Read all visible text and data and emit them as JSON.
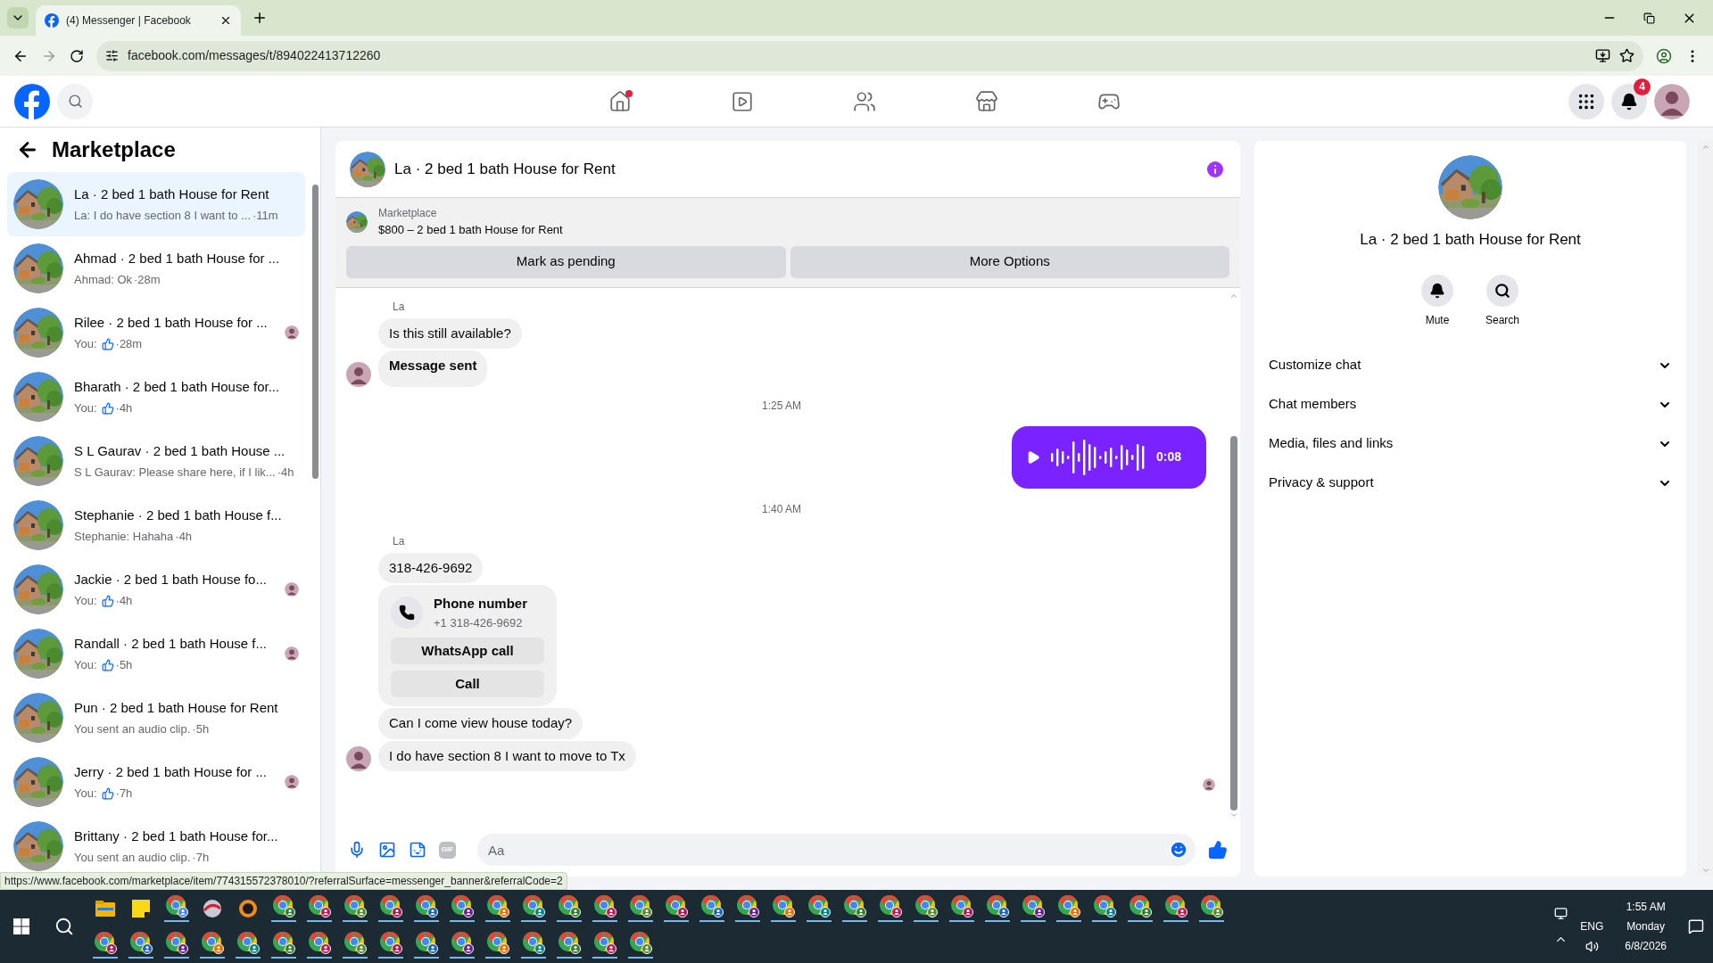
{
  "browser": {
    "tab_title": "(4) Messenger | Facebook",
    "url": "facebook.com/messages/t/894022413712260",
    "status_url": "https://www.facebook.com/marketplace/item/774315572378010/?referralSurface=messenger_banner&referralCode=2"
  },
  "header": {
    "nav": [
      {
        "kind": "home",
        "dot": true
      },
      {
        "kind": "video",
        "dot": false
      },
      {
        "kind": "friends",
        "dot": false
      },
      {
        "kind": "marketplace",
        "dot": false
      },
      {
        "kind": "gaming",
        "dot": false
      }
    ],
    "notification_count": "4"
  },
  "sidebar": {
    "title": "Marketplace",
    "conversations": [
      {
        "title": "La · 2 bed 1 bath House for Rent",
        "kind": "text",
        "preview": "La: I do have section 8 I want to ...",
        "time": " ·11m",
        "selected": true,
        "read_receipt": false
      },
      {
        "title": "Ahmad · 2 bed 1 bath House for ...",
        "kind": "text",
        "preview": "Ahmad: Ok",
        "time": "·28m",
        "selected": false,
        "read_receipt": false
      },
      {
        "title": "Rilee · 2 bed 1 bath House for ...",
        "kind": "like",
        "preview": "You:",
        "time": "·28m",
        "selected": false,
        "read_receipt": true
      },
      {
        "title": "Bharath · 2 bed 1 bath House for...",
        "kind": "like",
        "preview": "You:",
        "time": "·4h",
        "selected": false,
        "read_receipt": false
      },
      {
        "title": "S L Gaurav · 2 bed 1 bath House ...",
        "kind": "text",
        "preview": "S L Gaurav: Please share here, if I lik...",
        "time": "·4h",
        "selected": false,
        "read_receipt": false
      },
      {
        "title": "Stephanie · 2 bed 1 bath House f...",
        "kind": "text",
        "preview": "Stephanie: Hahaha",
        "time": "·4h",
        "selected": false,
        "read_receipt": false
      },
      {
        "title": "Jackie · 2 bed 1 bath House fo...",
        "kind": "like",
        "preview": "You:",
        "time": "·4h",
        "selected": false,
        "read_receipt": true
      },
      {
        "title": "Randall · 2 bed 1 bath House f...",
        "kind": "like",
        "preview": "You:",
        "time": "·5h",
        "selected": false,
        "read_receipt": true
      },
      {
        "title": "Pun · 2 bed 1 bath House for Rent",
        "kind": "text",
        "preview": "You sent an audio clip.",
        "time": "·5h",
        "selected": false,
        "read_receipt": false
      },
      {
        "title": "Jerry · 2 bed 1 bath House for ...",
        "kind": "like",
        "preview": "You:",
        "time": "·7h",
        "selected": false,
        "read_receipt": true
      },
      {
        "title": "Brittany · 2 bed 1 bath House for...",
        "kind": "text",
        "preview": "You sent an audio clip.",
        "time": "·7h",
        "selected": false,
        "read_receipt": false
      }
    ]
  },
  "chat": {
    "title": "La · 2 bed 1 bath House for Rent",
    "listing": {
      "label": "Marketplace",
      "text": "$800 – 2 bed 1 bath House for Rent"
    },
    "actions": [
      "Mark as pending",
      "More Options"
    ],
    "messages": [
      {
        "kind": "sender",
        "text": "La"
      },
      {
        "kind": "incoming",
        "text": "Is this still available?",
        "bold": false,
        "avatar": false
      },
      {
        "kind": "incoming",
        "text": "Message sent",
        "bold": true,
        "avatar": true
      },
      {
        "kind": "time",
        "text": "1:25 AM"
      },
      {
        "kind": "audio",
        "duration": "0:08"
      },
      {
        "kind": "time",
        "text": "1:40 AM"
      },
      {
        "kind": "sender",
        "text": "La"
      },
      {
        "kind": "incoming",
        "text": "318-426-9692",
        "bold": false,
        "avatar": false
      },
      {
        "kind": "contact",
        "title": "Phone number",
        "subtitle": "+1 318-426-9692",
        "buttons": [
          "WhatsApp call",
          "Call"
        ]
      },
      {
        "kind": "incoming",
        "text": "Can I come view house today?",
        "bold": false,
        "avatar": false
      },
      {
        "kind": "incoming",
        "text": "I do have section 8 I want to move to Tx",
        "bold": false,
        "avatar": true
      }
    ],
    "composer": {
      "placeholder": "Aa",
      "gif_label": "GIF"
    }
  },
  "details": {
    "title": "La · 2 bed 1 bath House for Rent",
    "actions": [
      {
        "kind": "mute",
        "label": "Mute"
      },
      {
        "kind": "search",
        "label": "Search"
      }
    ],
    "sections": [
      {
        "label": "Customize chat",
        "expanded": false
      },
      {
        "label": "Chat members",
        "expanded": false
      },
      {
        "label": "Media, files and links",
        "expanded": false
      },
      {
        "label": "Privacy & support",
        "expanded": false
      }
    ]
  },
  "taskbar": {
    "language": "ENG",
    "time": "1:55 AM",
    "day": "Monday",
    "date": "6/8/2026"
  }
}
